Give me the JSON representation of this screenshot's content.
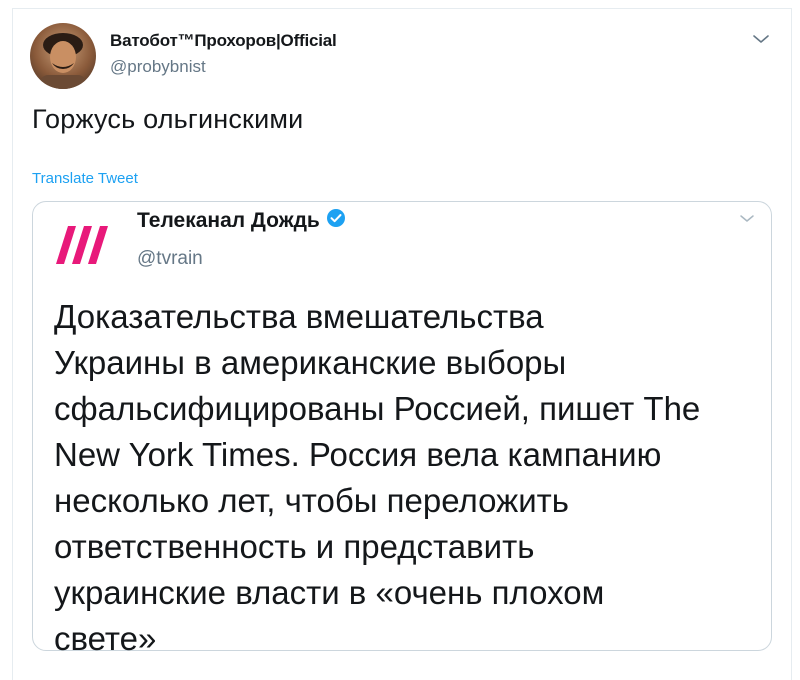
{
  "tweet": {
    "author_name": "Ватобот™Прохоров|Official",
    "author_handle": "@probybnist",
    "text": "Горжусь ольгинскими",
    "translate_label": "Translate Tweet",
    "avatar_icon": "user-avatar",
    "menu_icon": "chevron-down-icon"
  },
  "quoted": {
    "author_name": "Телеканал Дождь",
    "author_handle": "@tvrain",
    "verified_icon": "verified-badge-icon",
    "logo_icon": "dozhd-logo-icon",
    "menu_icon": "chevron-down-icon",
    "text": "Доказательства вмешательства\nУкраины в американские выборы\nсфальсифицированы Россией, пишет The\nNew York Times. Россия вела кампанию\nнесколько лет, чтобы переложить\nответственность и представить\nукраинские власти в «очень плохом\nсвете»"
  },
  "colors": {
    "accent": "#1da1f2",
    "muted": "#657786",
    "logo_pink": "#e8197a",
    "border": "#ccd6dd"
  }
}
